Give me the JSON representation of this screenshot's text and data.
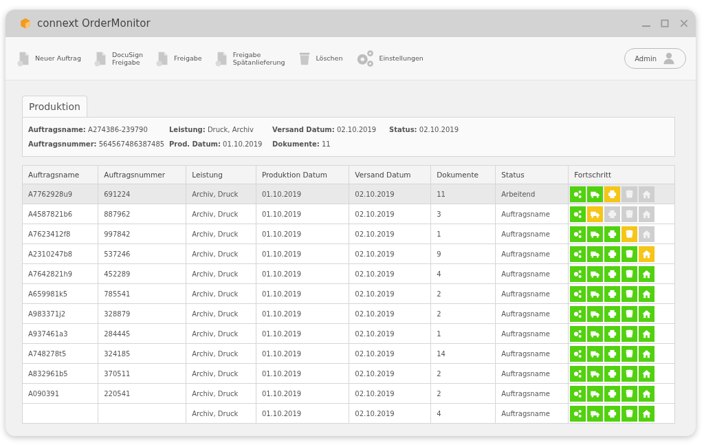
{
  "window": {
    "title": "connext OrderMonitor"
  },
  "toolbar": [
    {
      "kind": "new",
      "lines": [
        "Neuer Auftrag"
      ]
    },
    {
      "kind": "sign",
      "lines": [
        "DocuSign",
        "Freigabe"
      ]
    },
    {
      "kind": "approve",
      "lines": [
        "Freigabe"
      ]
    },
    {
      "kind": "late",
      "lines": [
        "Freigabe",
        "Spätanlieferung"
      ]
    },
    {
      "kind": "delete",
      "lines": [
        "Löschen"
      ]
    },
    {
      "kind": "settings",
      "lines": [
        "Einstellungen"
      ]
    }
  ],
  "user": {
    "label": "Admin"
  },
  "tabs": [
    {
      "label": "Produktion",
      "selected": true
    }
  ],
  "details": [
    {
      "label": "Auftragsname:",
      "value": "A274386-239790"
    },
    {
      "label": "Auftragsnummer:",
      "value": "564567486387485"
    },
    {
      "label": "Leistung:",
      "value": "Druck, Archiv"
    },
    {
      "label": "Prod. Datum:",
      "value": "01.10.2019"
    },
    {
      "label": "Versand Datum:",
      "value": "02.10.2019"
    },
    {
      "label": "Dokumente:",
      "value": "11"
    },
    {
      "label": "Status:",
      "value": "02.10.2019"
    }
  ],
  "table": {
    "columns": [
      "Auftragsname",
      "Auftragsnummer",
      "Leistung",
      "Produktion Datum",
      "Versand Datum",
      "Dokumente",
      "Status",
      "Fortschritt"
    ],
    "rows": [
      {
        "selected": true,
        "cells": [
          "A7762928u9",
          "691224",
          "Archiv, Druck",
          "01.10.2019",
          "02.10.2019",
          "11",
          "Arbeitend"
        ],
        "progress": [
          {
            "kind": "done"
          },
          {
            "kind": "done"
          },
          {
            "kind": "active"
          },
          {
            "kind": "pending"
          },
          {
            "kind": "pending"
          }
        ]
      },
      {
        "selected": false,
        "cells": [
          "A4587821b6",
          "887962",
          "Archiv, Druck",
          "01.10.2019",
          "02.10.2019",
          "3",
          "Auftragsname"
        ],
        "progress": [
          {
            "kind": "done"
          },
          {
            "kind": "active"
          },
          {
            "kind": "pending"
          },
          {
            "kind": "pending"
          },
          {
            "kind": "pending"
          }
        ]
      },
      {
        "selected": false,
        "cells": [
          "A7623412f8",
          "997842",
          "Archiv, Druck",
          "01.10.2019",
          "02.10.2019",
          "1",
          "Auftragsname"
        ],
        "progress": [
          {
            "kind": "done"
          },
          {
            "kind": "done"
          },
          {
            "kind": "done"
          },
          {
            "kind": "active"
          },
          {
            "kind": "pending"
          }
        ]
      },
      {
        "selected": false,
        "cells": [
          "A2310247b8",
          "537246",
          "Archiv, Druck",
          "01.10.2019",
          "02.10.2019",
          "9",
          "Auftragsname"
        ],
        "progress": [
          {
            "kind": "done"
          },
          {
            "kind": "done"
          },
          {
            "kind": "done"
          },
          {
            "kind": "done"
          },
          {
            "kind": "active"
          }
        ]
      },
      {
        "selected": false,
        "cells": [
          "A7642821h9",
          "452289",
          "Archiv, Druck",
          "01.10.2019",
          "02.10.2019",
          "4",
          "Auftragsname"
        ],
        "progress": [
          {
            "kind": "done"
          },
          {
            "kind": "done"
          },
          {
            "kind": "done"
          },
          {
            "kind": "done"
          },
          {
            "kind": "done"
          }
        ]
      },
      {
        "selected": false,
        "cells": [
          "A659981k5",
          "785541",
          "Archiv, Druck",
          "01.10.2019",
          "02.10.2019",
          "2",
          "Auftragsname"
        ],
        "progress": [
          {
            "kind": "done"
          },
          {
            "kind": "done"
          },
          {
            "kind": "done"
          },
          {
            "kind": "done"
          },
          {
            "kind": "done"
          }
        ]
      },
      {
        "selected": false,
        "cells": [
          "A983371j2",
          "328879",
          "Archiv, Druck",
          "01.10.2019",
          "02.10.2019",
          "2",
          "Auftragsname"
        ],
        "progress": [
          {
            "kind": "done"
          },
          {
            "kind": "done"
          },
          {
            "kind": "done"
          },
          {
            "kind": "done"
          },
          {
            "kind": "done"
          }
        ]
      },
      {
        "selected": false,
        "cells": [
          "A937461a3",
          "284445",
          "Archiv, Druck",
          "01.10.2019",
          "02.10.2019",
          "1",
          "Auftragsname"
        ],
        "progress": [
          {
            "kind": "done"
          },
          {
            "kind": "done"
          },
          {
            "kind": "done"
          },
          {
            "kind": "done"
          },
          {
            "kind": "done"
          }
        ]
      },
      {
        "selected": false,
        "cells": [
          "A748278t5",
          "324185",
          "Archiv, Druck",
          "01.10.2019",
          "02.10.2019",
          "14",
          "Auftragsname"
        ],
        "progress": [
          {
            "kind": "done"
          },
          {
            "kind": "done"
          },
          {
            "kind": "done"
          },
          {
            "kind": "done"
          },
          {
            "kind": "done"
          }
        ]
      },
      {
        "selected": false,
        "cells": [
          "A832961b5",
          "370511",
          "Archiv, Druck",
          "01.10.2019",
          "02.10.2019",
          "2",
          "Auftragsname"
        ],
        "progress": [
          {
            "kind": "done"
          },
          {
            "kind": "done"
          },
          {
            "kind": "done"
          },
          {
            "kind": "done"
          },
          {
            "kind": "done"
          }
        ]
      },
      {
        "selected": false,
        "cells": [
          "A090391",
          "220541",
          "Archiv, Druck",
          "01.10.2019",
          "02.10.2019",
          "2",
          "Auftragsname"
        ],
        "progress": [
          {
            "kind": "done"
          },
          {
            "kind": "done"
          },
          {
            "kind": "done"
          },
          {
            "kind": "done"
          },
          {
            "kind": "done"
          }
        ]
      },
      {
        "selected": false,
        "cells": [
          "",
          "",
          "Archiv, Druck",
          "01.10.2019",
          "02.10.2019",
          "4",
          "Auftragsname"
        ],
        "progress": [
          {
            "kind": "done"
          },
          {
            "kind": "done"
          },
          {
            "kind": "done"
          },
          {
            "kind": "done"
          },
          {
            "kind": "done"
          }
        ]
      }
    ]
  }
}
